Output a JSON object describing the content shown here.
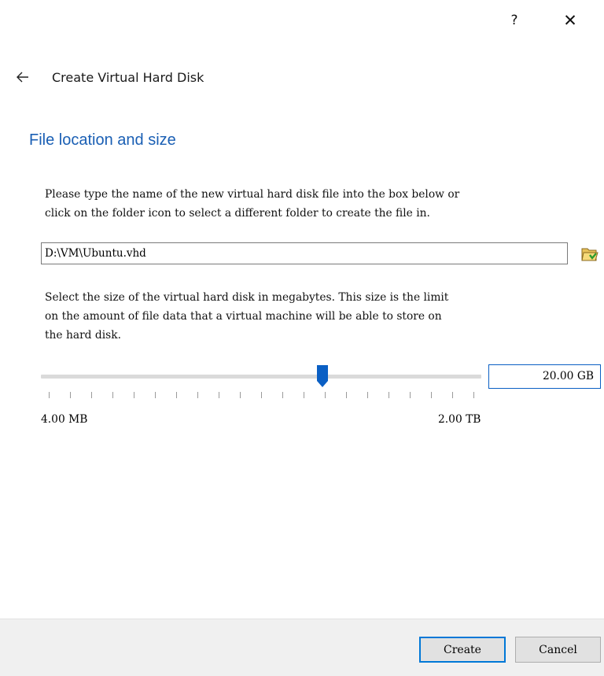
{
  "titlebar": {
    "help_label": "?",
    "close_label": "✕"
  },
  "header": {
    "title": "Create Virtual Hard Disk"
  },
  "section": {
    "title": "File location and size"
  },
  "location": {
    "description": "Please type the name of the new virtual hard disk file into the box below or\nclick on the folder icon to select a different folder to create the file in.",
    "path_value": "D:\\VM\\Ubuntu.vhd",
    "folder_icon": "folder-open-icon"
  },
  "size": {
    "description": "Select the size of the virtual hard disk in megabytes. This size is the limit\non the amount of file data that a virtual machine will be able to store on\nthe hard disk.",
    "value_label": "20.00 GB",
    "slider_fraction": 0.64,
    "min_label": "4.00 MB",
    "max_label": "2.00 TB",
    "tick_count": 21
  },
  "footer": {
    "create_label": "Create",
    "cancel_label": "Cancel"
  },
  "colors": {
    "accent": "#0078d7",
    "section_title": "#1a5fb4",
    "footer_bg": "#f0f0f0"
  }
}
